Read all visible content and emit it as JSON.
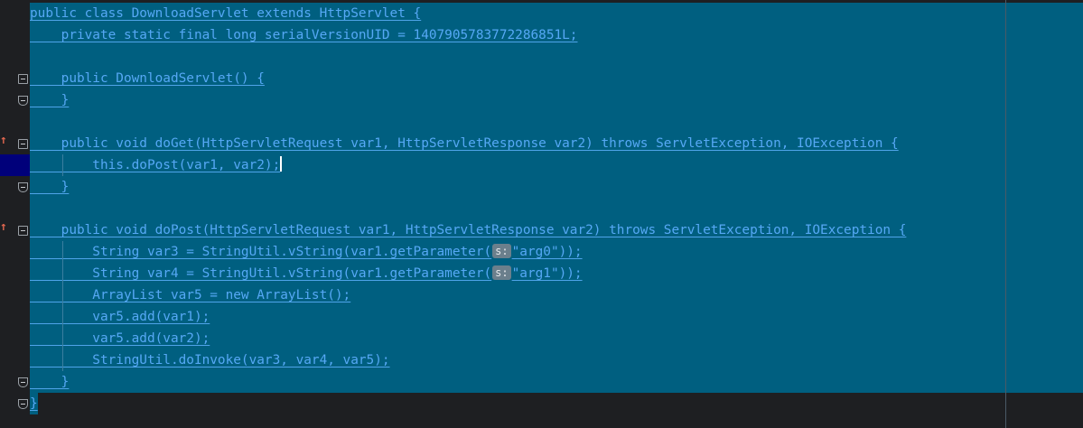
{
  "editor": {
    "lines": [
      {
        "text": "public class DownloadServlet extends HttpServlet {"
      },
      {
        "text": "    private static final long serialVersionUID = 1407905783772286851L;"
      },
      {
        "text": ""
      },
      {
        "text": "    public DownloadServlet() {"
      },
      {
        "text": "    }"
      },
      {
        "text": ""
      },
      {
        "text": "    public void doGet(HttpServletRequest var1, HttpServletResponse var2) throws ServletException, IOException {"
      },
      {
        "text": "        this.doPost(var1, var2);"
      },
      {
        "text": "    }"
      },
      {
        "text": ""
      },
      {
        "text": "    public void doPost(HttpServletRequest var1, HttpServletResponse var2) throws ServletException, IOException {"
      },
      {
        "text": "        String var3 = StringUtil.vString(var1.getParameter(",
        "hint": "s:",
        "text_after": "\"arg0\"));"
      },
      {
        "text": "        String var4 = StringUtil.vString(var1.getParameter(",
        "hint": "s:",
        "text_after": "\"arg1\"));"
      },
      {
        "text": "        ArrayList var5 = new ArrayList();"
      },
      {
        "text": "        var5.add(var1);"
      },
      {
        "text": "        var5.add(var2);"
      },
      {
        "text": "        StringUtil.doInvoke(var3, var4, var5);"
      },
      {
        "text": "    }"
      },
      {
        "text": "}"
      }
    ]
  },
  "colors": {
    "background": "#1e1f22",
    "selection": "#005f80",
    "code_text": "#56a8f5",
    "caret_line_gutter": "#00007a",
    "override_marker": "#e0664f"
  },
  "icons": {
    "fold": "fold-icon",
    "override": "override-icon"
  }
}
